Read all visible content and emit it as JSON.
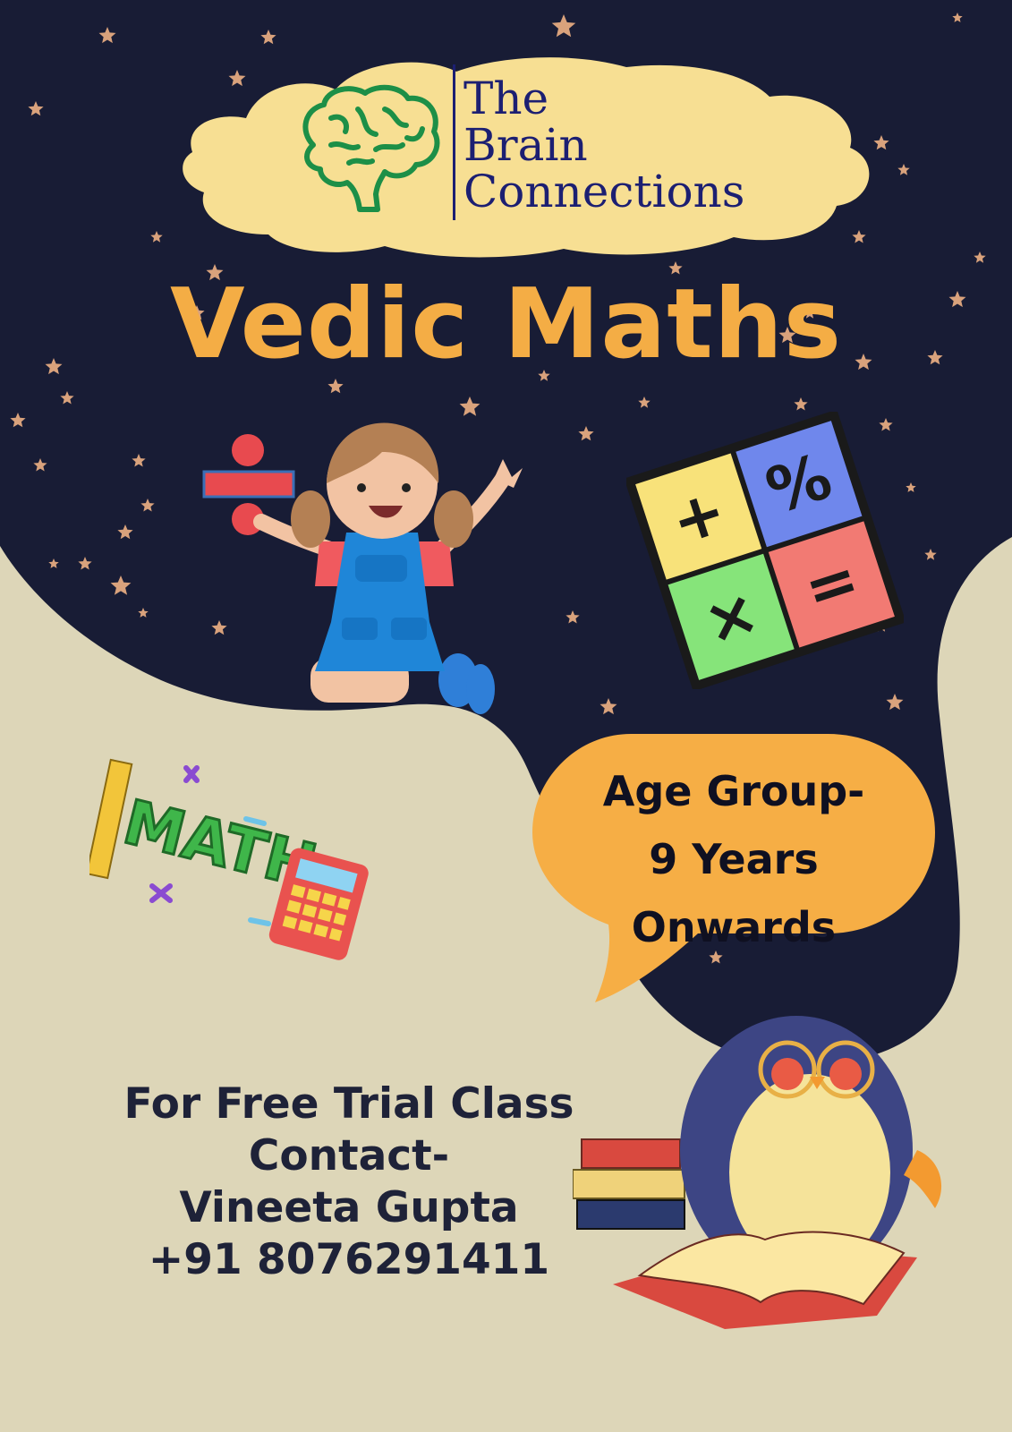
{
  "colors": {
    "night": "#181c35",
    "sand": "#ddd6b8",
    "cloud": "#f7df93",
    "headline": "#f4ad45",
    "bubble": "#f6ae45",
    "navy_text": "#1c1f72",
    "star": "#d9a27c"
  },
  "logo": {
    "icon": "brain-icon",
    "line1": "The",
    "line2": "Brain",
    "line3": "Connections"
  },
  "headline": "Vedic Maths",
  "illustrations": {
    "girl": "girl-with-divide-sign-icon",
    "operator_grid": "math-operators-grid-icon",
    "math_sticker": "math-sticker-icon",
    "sticker_word": "MATH",
    "penguin": "penguin-reading-icon"
  },
  "operators": [
    "+",
    "%",
    "×",
    "="
  ],
  "bubble": {
    "line1": "Age Group-",
    "line2": "9 Years",
    "line3": "Onwards"
  },
  "contact": {
    "line1": "For Free Trial Class",
    "line2": "Contact-",
    "line3": "Vineeta Gupta",
    "line4": "+91 8076291411"
  }
}
